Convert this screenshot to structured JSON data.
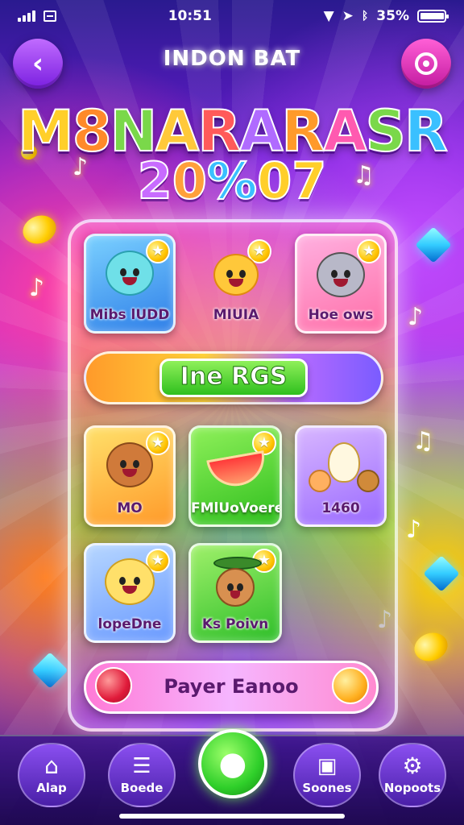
{
  "status_bar": {
    "time": "10:51",
    "battery": "35%",
    "battery_level": 0.95
  },
  "header": {
    "title": "INDON BAT"
  },
  "logo": {
    "main": [
      "M",
      "8",
      "N",
      "A",
      "R",
      "A",
      "R",
      "A",
      "S",
      "R"
    ],
    "main_colors": [
      "#ffcf2a",
      "#ff8a2a",
      "#7ad84a",
      "#ffc93a",
      "#ff5a5a",
      "#b06bff",
      "#ff9a2a",
      "#ff5ab0",
      "#7ad84a",
      "#3ac0ff"
    ],
    "sub": [
      "2",
      "0",
      "%",
      "0",
      "7"
    ],
    "sub_colors": [
      "#c86bff",
      "#ffa03a",
      "#3ac0ff",
      "#ffcf2a",
      "#ffcf2a"
    ]
  },
  "cards_top": [
    {
      "label": "Mibs lUDD",
      "bg": "#3ab0ff"
    },
    {
      "label": "MIUIA",
      "bg": "transparent"
    },
    {
      "label": "Hoe ows",
      "bg": "#ff8ad0"
    }
  ],
  "banner": {
    "button_label": "Ine RGS"
  },
  "cards_mid": [
    {
      "label": "MO",
      "bg": "#ffb02a"
    },
    {
      "label": "FMlUoVoere",
      "bg": "#48d02a"
    },
    {
      "label": "1460",
      "bg": "#b78aff"
    }
  ],
  "cards_bottom": [
    {
      "label": "lopeDne",
      "bg": "#7ab6ff"
    },
    {
      "label": "Ks Poivn",
      "bg": "#4fd03a"
    }
  ],
  "player_bar": {
    "label": "Payer Eanoo"
  },
  "nav": {
    "items": [
      {
        "label": "Alap",
        "icon": "home-icon"
      },
      {
        "label": "Boede",
        "icon": "list-icon"
      },
      {
        "label": "Soones",
        "icon": "bag-icon"
      },
      {
        "label": "Nopoots",
        "icon": "gear-icon"
      }
    ],
    "center_icon": "play-icon"
  }
}
